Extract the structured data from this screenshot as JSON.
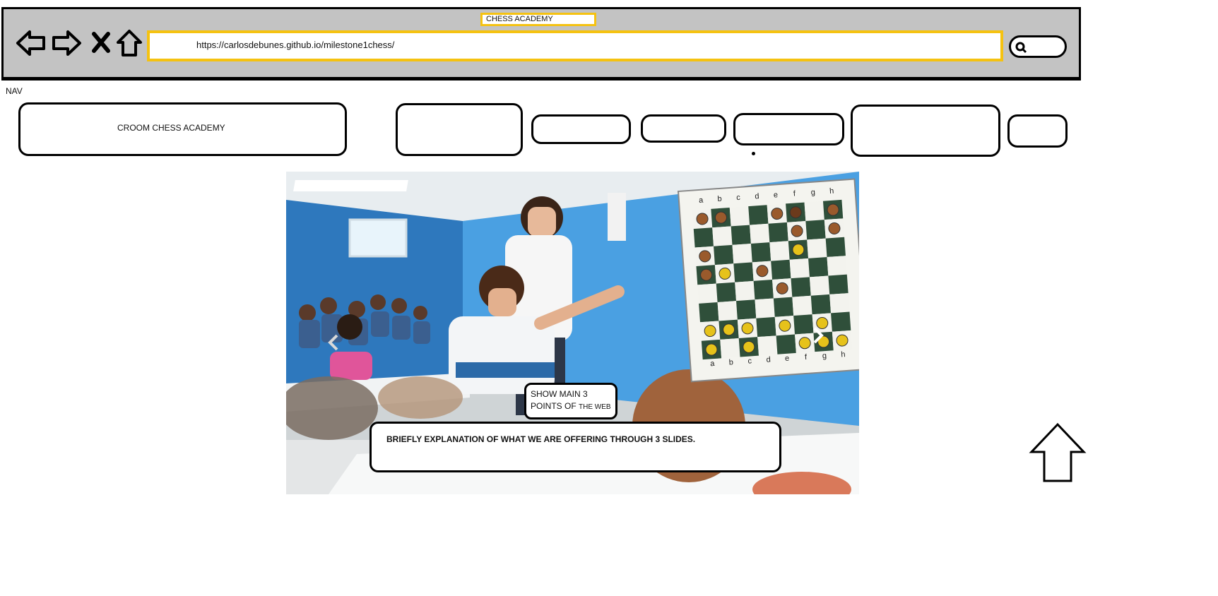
{
  "browser": {
    "tab_title": "CHESS ACADEMY",
    "url": "https://carlosdebunes.github.io/milestone1chess/",
    "icons": [
      "back-arrow-icon",
      "forward-arrow-icon",
      "close-icon",
      "home-icon",
      "search-icon"
    ]
  },
  "nav": {
    "label": "NAV",
    "brand": "CROOM CHESS ACADEMY"
  },
  "carousel": {
    "caption_title_line1": "SHOW MAIN 3",
    "caption_title_line2_big": "POINTS OF ",
    "caption_title_line2_small": "THE WEB",
    "caption_text": "BRIEFLY EXPLANATION OF WHAT WE ARE OFFERING THROUGH 3 SLIDES.",
    "board_files": [
      "a",
      "b",
      "c",
      "d",
      "e",
      "f",
      "g",
      "h"
    ],
    "icons": [
      "chevron-left-icon",
      "chevron-right-icon"
    ]
  },
  "back_to_top": {
    "icon": "up-arrow-icon"
  }
}
